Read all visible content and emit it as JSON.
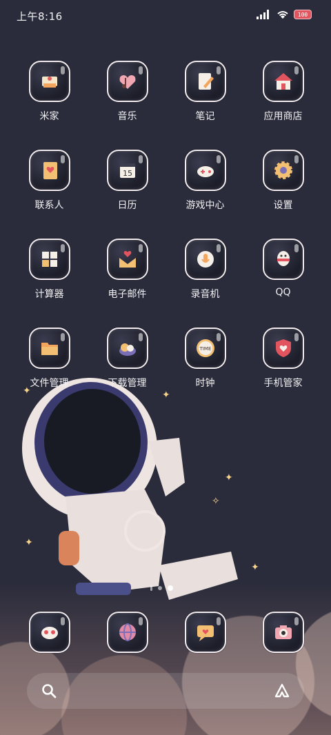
{
  "status": {
    "time": "上午8:16",
    "battery": "100"
  },
  "apps": [
    [
      {
        "label": "米家",
        "icon": "mi-home-icon"
      },
      {
        "label": "音乐",
        "icon": "music-icon"
      },
      {
        "label": "笔记",
        "icon": "notes-icon"
      },
      {
        "label": "应用商店",
        "icon": "app-store-icon"
      }
    ],
    [
      {
        "label": "联系人",
        "icon": "contacts-icon"
      },
      {
        "label": "日历",
        "icon": "calendar-icon",
        "icon_text": "15"
      },
      {
        "label": "游戏中心",
        "icon": "game-center-icon"
      },
      {
        "label": "设置",
        "icon": "settings-icon"
      }
    ],
    [
      {
        "label": "计算器",
        "icon": "calculator-icon"
      },
      {
        "label": "电子邮件",
        "icon": "email-icon"
      },
      {
        "label": "录音机",
        "icon": "recorder-icon"
      },
      {
        "label": "QQ",
        "icon": "qq-icon"
      }
    ],
    [
      {
        "label": "文件管理",
        "icon": "file-manager-icon"
      },
      {
        "label": "下载管理",
        "icon": "download-manager-icon"
      },
      {
        "label": "时钟",
        "icon": "clock-icon",
        "icon_text": "TIME"
      },
      {
        "label": "手机管家",
        "icon": "security-icon"
      }
    ]
  ],
  "dock": [
    {
      "icon": "camera-face-icon"
    },
    {
      "icon": "browser-globe-icon"
    },
    {
      "icon": "messages-icon"
    },
    {
      "icon": "camera-icon"
    }
  ],
  "colors": {
    "accent": "#f5a35a",
    "background": "#2b2c3b"
  }
}
